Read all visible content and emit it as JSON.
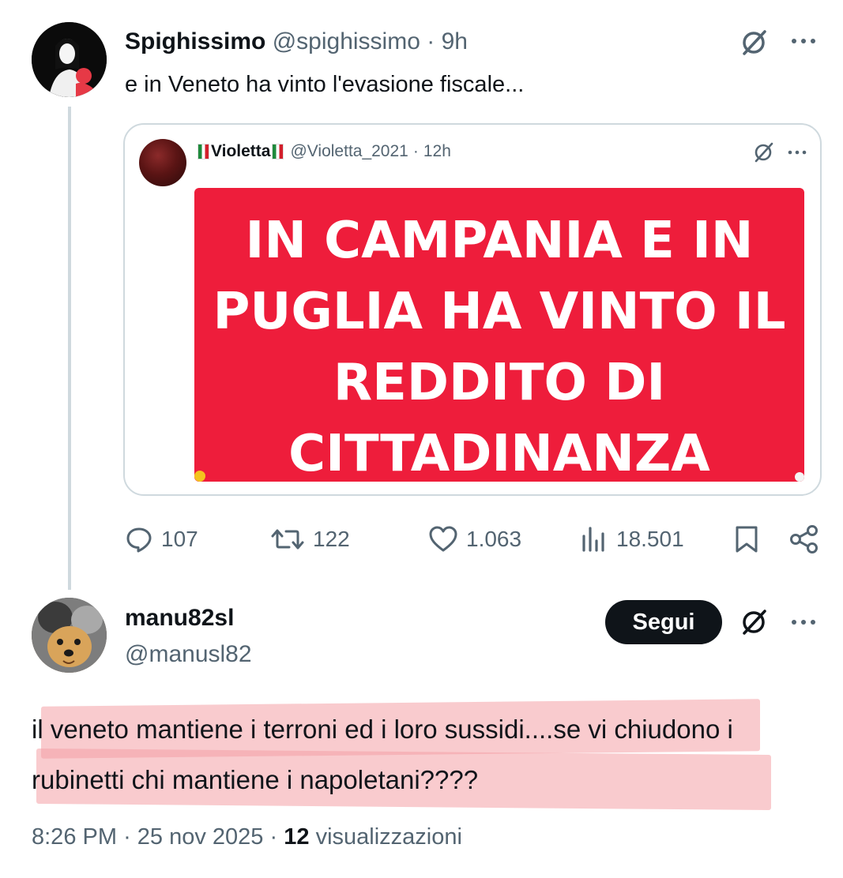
{
  "tweet1": {
    "author_name": "Spighissimo",
    "author_handle": "@spighissimo",
    "separator": "·",
    "time": "9h",
    "text": "e in Veneto ha vinto l'evasione fiscale...",
    "quote": {
      "author_name": "Violetta",
      "author_handle": "@Violetta_2021",
      "separator": "·",
      "time": "12h",
      "image_text": "IN CAMPANIA E IN\nPUGLIA HA VINTO IL\nREDDITO DI\nCITTADINANZA",
      "image_background": "#ee1d3b"
    },
    "actions": {
      "replies": "107",
      "retweets": "122",
      "likes": "1.063",
      "views": "18.501"
    }
  },
  "tweet2": {
    "author_name": "manu82sl",
    "author_handle": "@manusl82",
    "follow_label": "Segui",
    "text": "il veneto mantiene i terroni ed i loro sussidi....se vi chiudono i rubinetti chi mantiene i napoletani????",
    "time": "8:26 PM",
    "separator": "·",
    "date": "25 nov 2025",
    "views_count": "12",
    "views_label": "visualizzazioni"
  },
  "colors": {
    "text_primary": "#0f1419",
    "text_secondary": "#536471",
    "border": "#cfd9de",
    "highlight": "#f4a0a5",
    "button_bg": "#0f1419"
  },
  "icons": [
    "grok-icon",
    "more-icon",
    "reply-icon",
    "retweet-icon",
    "like-icon",
    "views-icon",
    "bookmark-icon",
    "share-icon"
  ]
}
